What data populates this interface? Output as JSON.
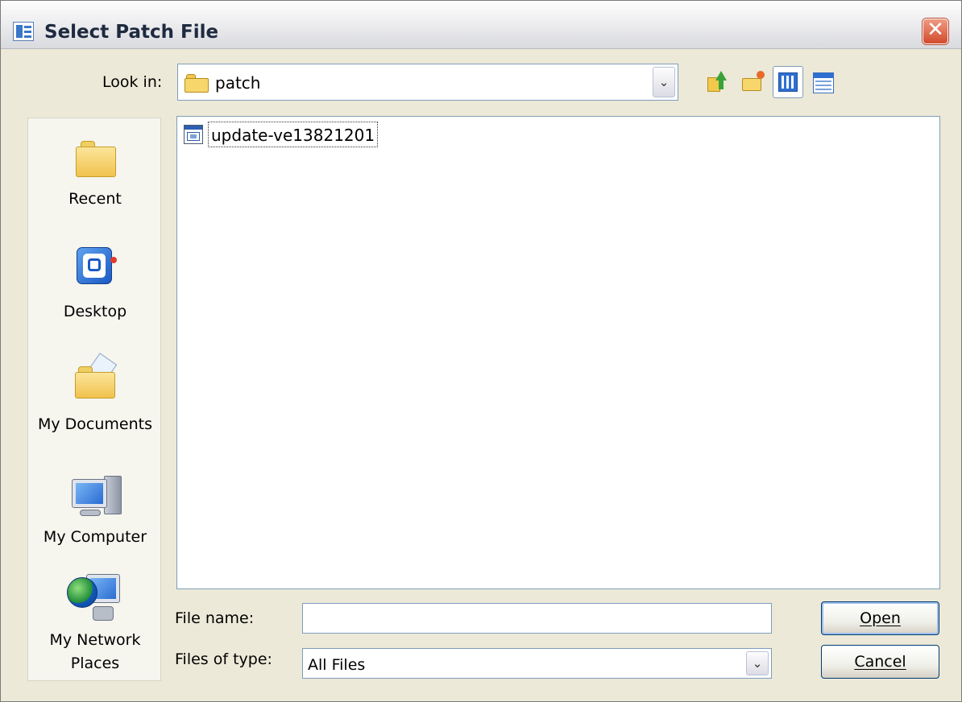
{
  "window": {
    "title": "Select Patch File",
    "close_glyph": "✕"
  },
  "lookin": {
    "label": "Look in:",
    "value": "patch",
    "dropdown_glyph": "⌄"
  },
  "places": [
    {
      "id": "recent",
      "label": "Recent",
      "icon": "recent-folder-icon"
    },
    {
      "id": "desktop",
      "label": "Desktop",
      "icon": "desktop-icon"
    },
    {
      "id": "my-documents",
      "label": "My Documents",
      "icon": "my-documents-icon"
    },
    {
      "id": "my-computer",
      "label": "My Computer",
      "icon": "my-computer-icon"
    },
    {
      "id": "my-network-places",
      "label": "My Network Places",
      "icon": "network-places-icon"
    }
  ],
  "files": [
    {
      "name": "update-ve13821201",
      "icon": "application-file-icon",
      "selected": true
    }
  ],
  "filename": {
    "label": "File name:",
    "value": ""
  },
  "filetype": {
    "label": "Files of type:",
    "value": "All Files",
    "dropdown_glyph": "⌄"
  },
  "buttons": {
    "open": "Open",
    "cancel": "Cancel"
  },
  "colors": {
    "dialog_bg": "#ece9d8",
    "field_border": "#7f9db9",
    "button_border": "#003c74",
    "close_button": "#d24a2c"
  }
}
